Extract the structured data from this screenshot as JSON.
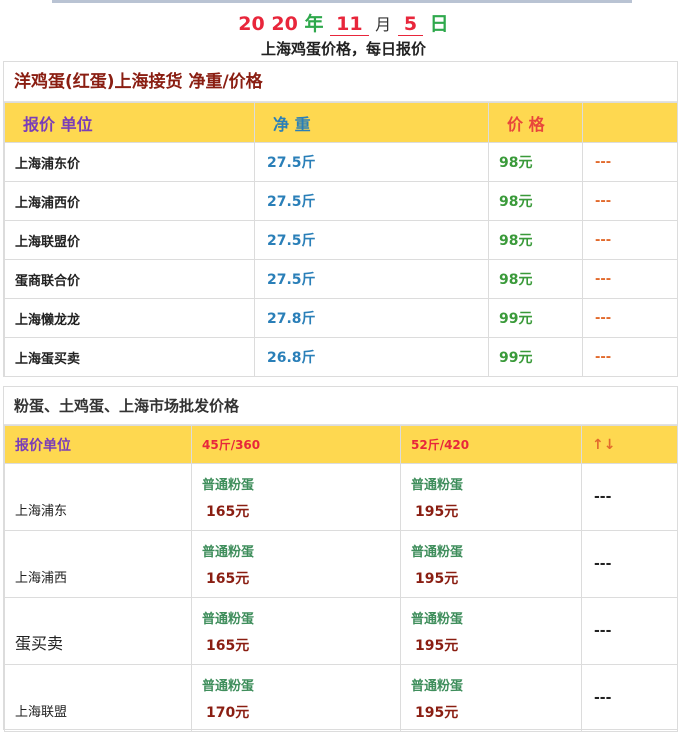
{
  "header": {
    "year_part1": "20",
    "year_part2": "20",
    "year_unit": "年",
    "month": "11",
    "month_unit": "月",
    "day": "5",
    "day_unit": "日",
    "subtitle": "上海鸡蛋价格，每日报价"
  },
  "section1": {
    "title": "洋鸡蛋(红蛋)上海接货 净重/价格",
    "columns": [
      "报价 单位",
      "净 重",
      "价 格",
      ""
    ],
    "rows": [
      {
        "name": "上海浦东价",
        "weight": "27.5斤",
        "price": "98元",
        "extra": "---"
      },
      {
        "name": "上海浦西价",
        "weight": "27.5斤",
        "price": "98元",
        "extra": "---"
      },
      {
        "name": "上海联盟价",
        "weight": "27.5斤",
        "price": "98元",
        "extra": "---"
      },
      {
        "name": "蛋商联合价",
        "weight": "27.5斤",
        "price": "98元",
        "extra": "---"
      },
      {
        "name": "上海懒龙龙",
        "weight": "27.8斤",
        "price": "99元",
        "extra": "---"
      },
      {
        "name": "上海蛋买卖",
        "weight": "26.8斤",
        "price": "99元",
        "extra": "---"
      }
    ]
  },
  "section2": {
    "title": "粉蛋、土鸡蛋、上海市场批发价格",
    "columns": [
      "报价单位",
      "45斤/360",
      "52斤/420",
      "↑↓"
    ],
    "rows": [
      {
        "name": "上海浦东",
        "a_type": "普通粉蛋",
        "a_price": "165元",
        "b_type": "普通粉蛋",
        "b_price": "195元",
        "extra": "---"
      },
      {
        "name": "上海浦西",
        "a_type": "普通粉蛋",
        "a_price": "165元",
        "b_type": "普通粉蛋",
        "b_price": "195元",
        "extra": "---"
      },
      {
        "name": "蛋买卖",
        "a_type": "普通粉蛋",
        "a_price": "165元",
        "b_type": "普通粉蛋",
        "b_price": "195元",
        "extra": "---"
      },
      {
        "name": "上海联盟",
        "a_type": "普通粉蛋",
        "a_price": "170元",
        "b_type": "普通粉蛋",
        "b_price": "195元",
        "extra": "---"
      }
    ]
  }
}
